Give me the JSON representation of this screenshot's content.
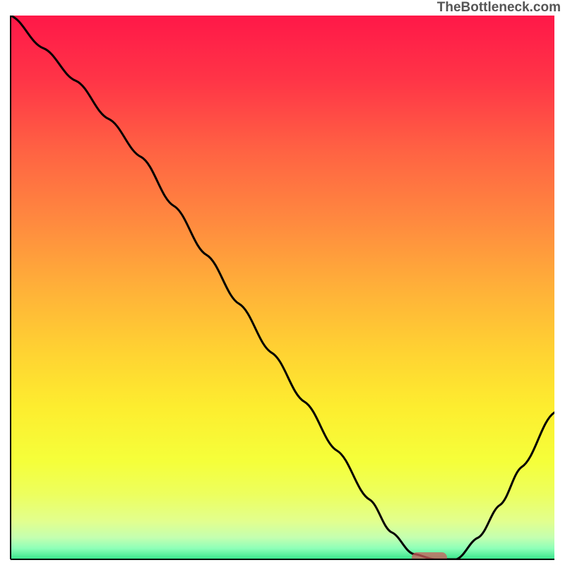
{
  "watermark": "TheBottleneck.com",
  "chart_data": {
    "type": "line",
    "title": "",
    "xlabel": "",
    "ylabel": "",
    "xlim": [
      0,
      100
    ],
    "ylim": [
      0,
      100
    ],
    "x": [
      0,
      6,
      12,
      18,
      24,
      30,
      36,
      42,
      48,
      54,
      60,
      66,
      70,
      74,
      78,
      82,
      86,
      90,
      94,
      100
    ],
    "values": [
      100,
      94,
      88,
      81,
      74,
      65,
      56,
      47,
      38,
      29,
      20,
      11,
      5,
      1,
      0,
      0,
      4,
      10,
      17,
      27
    ],
    "marker_x": 77,
    "marker_y": 0,
    "gradient_stops": [
      {
        "offset": 0.0,
        "color": "#ff1848"
      },
      {
        "offset": 0.12,
        "color": "#ff3547"
      },
      {
        "offset": 0.25,
        "color": "#ff6343"
      },
      {
        "offset": 0.38,
        "color": "#ff8a3f"
      },
      {
        "offset": 0.5,
        "color": "#ffb039"
      },
      {
        "offset": 0.62,
        "color": "#ffd332"
      },
      {
        "offset": 0.72,
        "color": "#fded2f"
      },
      {
        "offset": 0.82,
        "color": "#f5ff3a"
      },
      {
        "offset": 0.88,
        "color": "#edff5e"
      },
      {
        "offset": 0.93,
        "color": "#e2ff8e"
      },
      {
        "offset": 0.96,
        "color": "#c4ffb0"
      },
      {
        "offset": 0.98,
        "color": "#8dffb8"
      },
      {
        "offset": 1.0,
        "color": "#36e48a"
      }
    ]
  }
}
